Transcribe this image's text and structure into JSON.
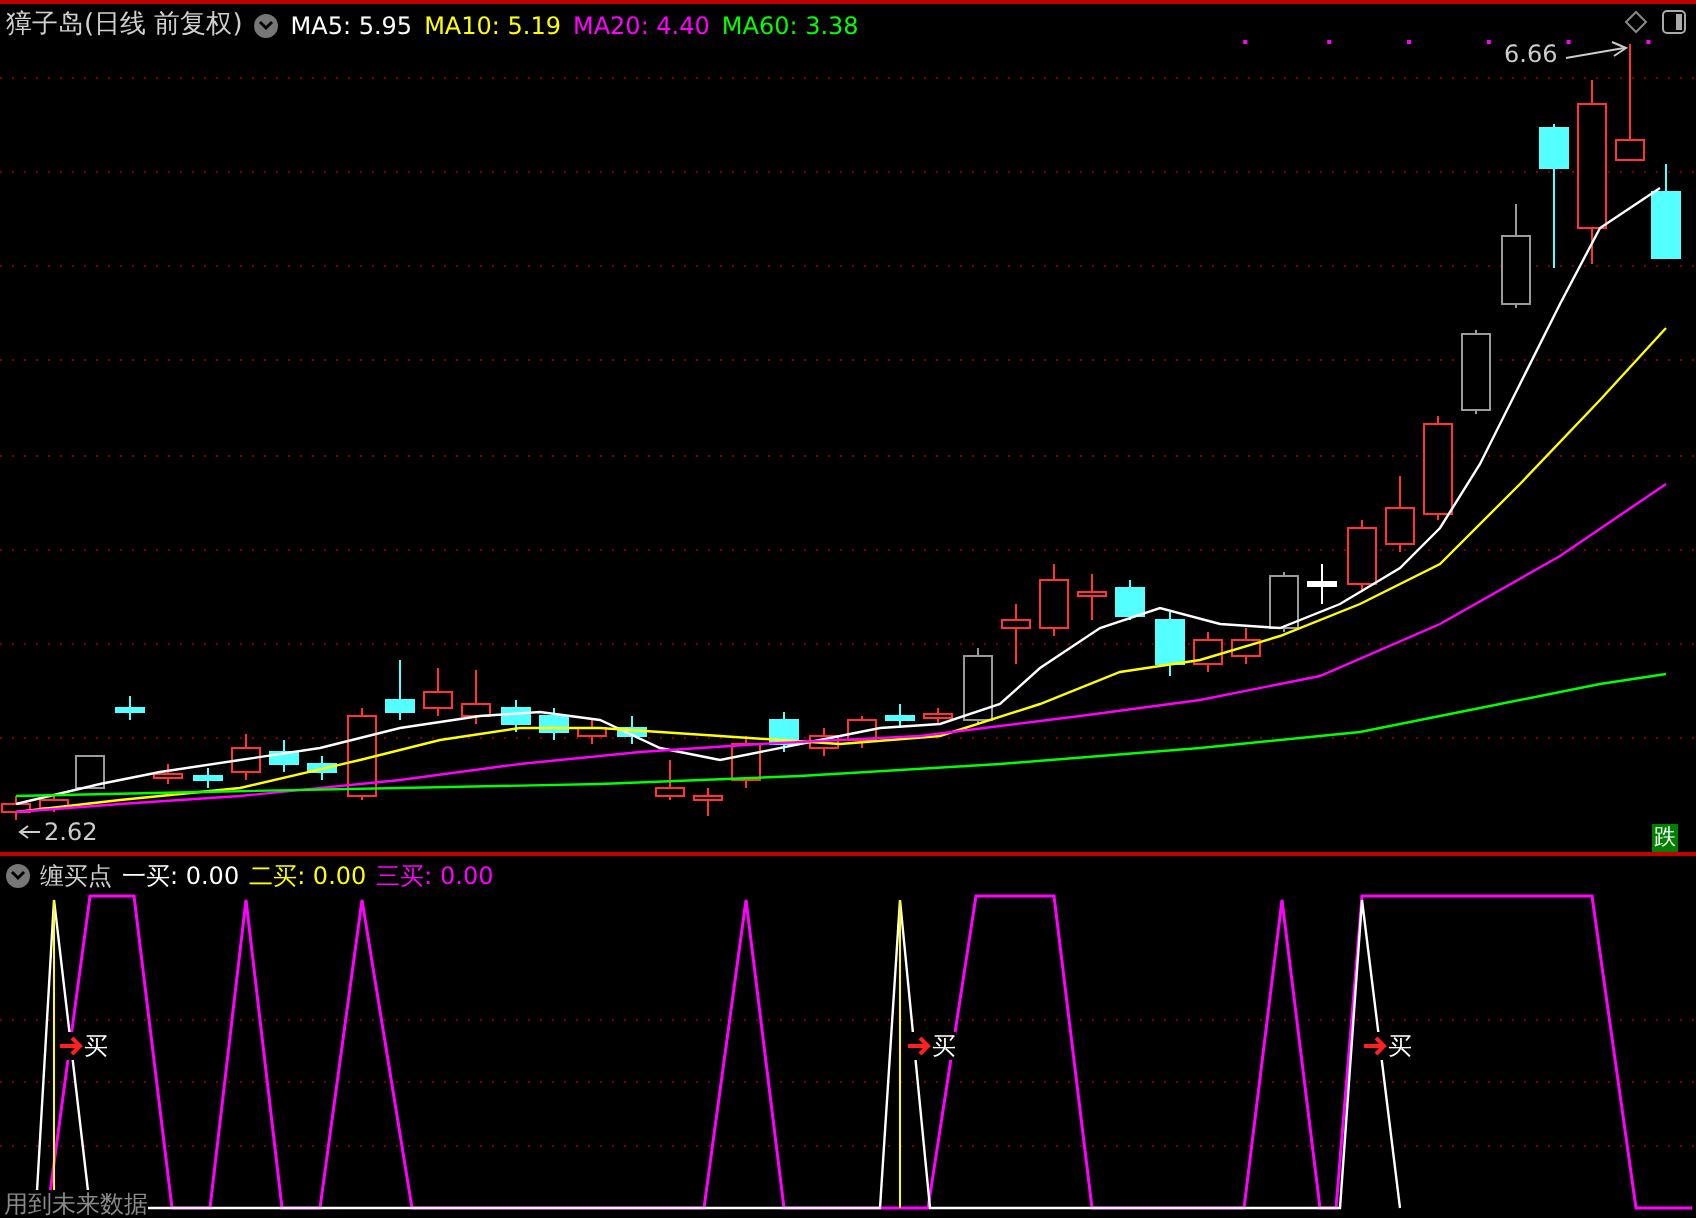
{
  "main_chart": {
    "title": "獐子岛(日线 前复权)",
    "moving_averages": [
      {
        "label": "MA5: 5.95",
        "color": "#ffffff"
      },
      {
        "label": "MA10: 5.19",
        "color": "#ffff00"
      },
      {
        "label": "MA20: 4.40",
        "color": "#ff00ff"
      },
      {
        "label": "MA60: 3.38",
        "color": "#00ff00"
      }
    ],
    "high_label": "6.66",
    "low_label": "2.62",
    "trend_badge": "跌"
  },
  "indicator": {
    "title": "缠买点",
    "values": [
      {
        "label": "一买: 0.00",
        "color": "#ffffff"
      },
      {
        "label": "二买: 0.00",
        "color": "#ffff00"
      },
      {
        "label": "三买: 0.00",
        "color": "#ff00ff"
      }
    ],
    "buy_markers": [
      {
        "label": "买"
      },
      {
        "label": "买"
      },
      {
        "label": "买"
      }
    ],
    "footer": "用到未来数据"
  }
}
